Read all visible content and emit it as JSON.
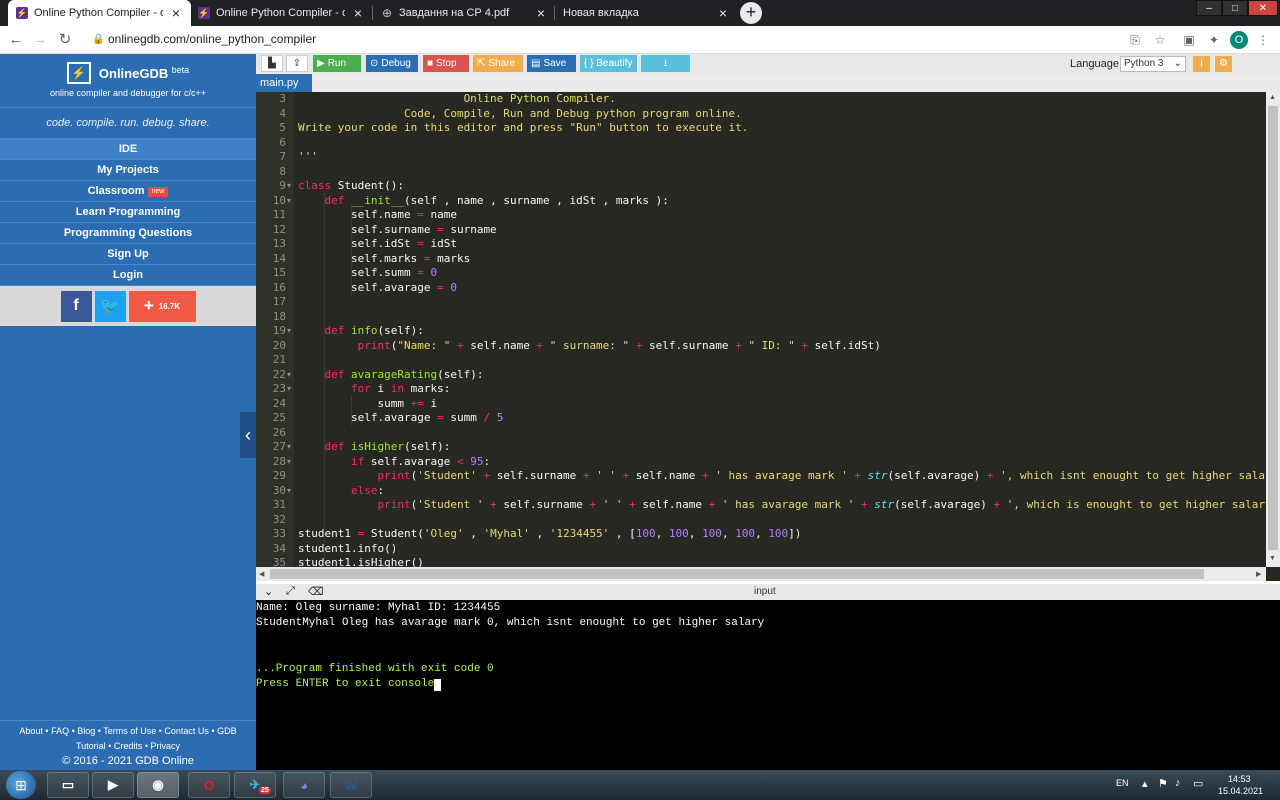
{
  "browser": {
    "tabs": [
      {
        "title": "Online Python Compiler - online",
        "icon": "onlinegdb-icon",
        "active": true
      },
      {
        "title": "Online Python Compiler - online",
        "icon": "onlinegdb-icon",
        "active": false
      },
      {
        "title": "Завдання на СР 4.pdf",
        "icon": "globe-icon",
        "active": false
      },
      {
        "title": "Новая вкладка",
        "icon": "",
        "active": false
      }
    ],
    "new_tab": "+",
    "url": "onlinegdb.com/online_python_compiler",
    "profile_initial": "O"
  },
  "sidebar": {
    "brand": "OnlineGDB",
    "beta": "beta",
    "subtitle": "online compiler and debugger for c/c++",
    "tagline": "code. compile. run. debug. share.",
    "nav": [
      {
        "label": "IDE",
        "selected": true
      },
      {
        "label": "My Projects"
      },
      {
        "label": "Classroom",
        "badge": "new"
      },
      {
        "label": "Learn Programming"
      },
      {
        "label": "Programming Questions"
      },
      {
        "label": "Sign Up"
      },
      {
        "label": "Login"
      }
    ],
    "share_count": "16.7K",
    "footer_line1": "About • FAQ • Blog • Terms of Use • Contact Us • GDB",
    "footer_line2": "Tutorial • Credits • Privacy",
    "footer_line3": "© 2016 - 2021 GDB Online"
  },
  "toolbar": {
    "run": "Run",
    "debug": "Debug",
    "stop": "Stop",
    "share": "Share",
    "save": "Save",
    "beautify": "{ } Beautify",
    "language_label": "Language",
    "language_value": "Python 3"
  },
  "file_tab": "main.py",
  "editor": {
    "first_line": 3,
    "fold_lines": [
      9,
      10,
      19,
      22,
      23,
      27,
      28,
      30
    ]
  },
  "console": {
    "header_label": "input",
    "lines": [
      {
        "text": "Name: Oleg surname: Myhal ID: 1234455",
        "style": "white"
      },
      {
        "text": "StudentMyhal Oleg has avarage mark 0, which isnt enought to get higher salary",
        "style": "white"
      },
      {
        "text": "",
        "style": "white"
      },
      {
        "text": "",
        "style": "white"
      },
      {
        "text": "...Program finished with exit code 0",
        "style": "green"
      },
      {
        "text": "Press ENTER to exit console.",
        "style": "green"
      }
    ]
  },
  "taskbar": {
    "language": "EN",
    "time": "14:53",
    "date": "15.04.2021",
    "telegram_badge": "25"
  },
  "colors": {
    "sidebar": "#2b6cb3",
    "editor_bg": "#272822",
    "run": "#4cae4c",
    "debug": "#2a6fb4",
    "stop": "#d9534f",
    "share": "#f0ad4e",
    "save": "#2a6fb4",
    "beautify": "#5bc0de"
  }
}
